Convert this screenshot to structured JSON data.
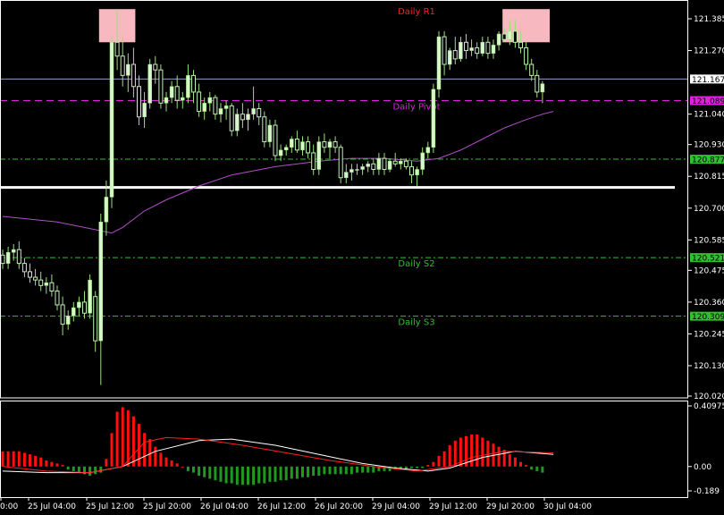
{
  "colors": {
    "background": "#000000",
    "bull_candle": "#d8f7c8",
    "bear_candle": "#c4f0bc",
    "wick": "#9be07f",
    "pivot": "#e020e0",
    "r1": "#ff2020",
    "support": "#2fbf2f",
    "bid_line": "#9999cc",
    "moving_average": "#b050c8",
    "highlight_box": "#f8b8c0",
    "hist_pos": "#ff1010",
    "hist_neg": "#1f9a1f",
    "signal_white": "#ffffff",
    "signal_red": "#ff2020"
  },
  "chart_data": [
    {
      "type": "candlestick",
      "ylim": [
        120.02,
        121.44
      ],
      "price_axis_ticks": [
        "121.385",
        "121.270",
        "121.040",
        "120.930",
        "120.815",
        "120.700",
        "120.585",
        "120.475",
        "120.360",
        "120.245",
        "120.130",
        "120.020"
      ],
      "time_axis_labels": [
        "0:00",
        "25 Jul 04:00",
        "25 Jul 12:00",
        "25 Jul 20:00",
        "26 Jul 04:00",
        "26 Jul 12:00",
        "26 Jul 20:00",
        "29 Jul 04:00",
        "29 Jul 12:00",
        "29 Jul 20:00",
        "30 Jul 04:00"
      ],
      "levels": [
        {
          "name": "Daily R1",
          "value": 121.43,
          "tag": ""
        },
        {
          "name": "Daily Pivot",
          "value": 121.089,
          "tag": "121.089"
        },
        {
          "name": "",
          "value": 120.877,
          "tag": "120.877"
        },
        {
          "name": "Daily S2",
          "value": 120.521,
          "tag": "120.521"
        },
        {
          "name": "Daily S3",
          "value": 120.309,
          "tag": "120.309"
        }
      ],
      "current_price": "121.167",
      "horizontal_line": 120.775,
      "highlight_boxes": [
        {
          "bar_from": 18,
          "bar_to": 24,
          "y_from": 121.3,
          "y_to": 121.42
        },
        {
          "bar_from": 92,
          "bar_to": 100,
          "y_from": 121.3,
          "y_to": 121.42
        }
      ],
      "candles": [
        [
          120.53,
          120.55,
          120.48,
          120.5
        ],
        [
          120.5,
          120.56,
          120.48,
          120.54
        ],
        [
          120.54,
          120.57,
          120.51,
          120.55
        ],
        [
          120.55,
          120.58,
          120.48,
          120.5
        ],
        [
          120.5,
          120.52,
          120.45,
          120.47
        ],
        [
          120.47,
          120.5,
          120.43,
          120.45
        ],
        [
          120.45,
          120.48,
          120.42,
          120.44
        ],
        [
          120.44,
          120.47,
          120.4,
          120.42
        ],
        [
          120.42,
          120.45,
          120.39,
          120.43
        ],
        [
          120.43,
          120.46,
          120.38,
          120.4
        ],
        [
          120.4,
          120.42,
          120.33,
          120.35
        ],
        [
          120.35,
          120.38,
          120.24,
          120.28
        ],
        [
          120.28,
          120.33,
          120.26,
          120.31
        ],
        [
          120.31,
          120.36,
          120.29,
          120.34
        ],
        [
          120.34,
          120.38,
          120.31,
          120.36
        ],
        [
          120.36,
          120.4,
          120.3,
          120.32
        ],
        [
          120.32,
          120.46,
          120.3,
          120.44
        ],
        [
          120.38,
          120.4,
          120.18,
          120.22
        ],
        [
          120.22,
          120.68,
          120.06,
          120.65
        ],
        [
          120.65,
          120.8,
          120.6,
          120.74
        ],
        [
          120.74,
          121.32,
          120.7,
          121.3
        ],
        [
          121.3,
          121.42,
          121.2,
          121.25
        ],
        [
          121.25,
          121.32,
          121.14,
          121.18
        ],
        [
          121.18,
          121.26,
          121.12,
          121.22
        ],
        [
          121.22,
          121.28,
          121.1,
          121.14
        ],
        [
          121.14,
          121.18,
          121.0,
          121.03
        ],
        [
          121.03,
          121.12,
          120.99,
          121.08
        ],
        [
          121.08,
          121.24,
          121.06,
          121.22
        ],
        [
          121.22,
          121.25,
          121.15,
          121.2
        ],
        [
          121.2,
          121.22,
          121.06,
          121.08
        ],
        [
          121.08,
          121.12,
          121.05,
          121.1
        ],
        [
          121.1,
          121.16,
          121.08,
          121.14
        ],
        [
          121.14,
          121.18,
          121.06,
          121.09
        ],
        [
          121.09,
          121.12,
          121.06,
          121.1
        ],
        [
          121.1,
          121.22,
          121.08,
          121.18
        ],
        [
          121.18,
          121.2,
          121.08,
          121.12
        ],
        [
          121.12,
          121.15,
          121.03,
          121.05
        ],
        [
          121.05,
          121.1,
          121.02,
          121.08
        ],
        [
          121.08,
          121.12,
          121.05,
          121.1
        ],
        [
          121.1,
          121.11,
          121.02,
          121.04
        ],
        [
          121.04,
          121.08,
          121.01,
          121.06
        ],
        [
          121.06,
          121.09,
          121.02,
          121.07
        ],
        [
          121.07,
          121.08,
          120.96,
          120.98
        ],
        [
          120.98,
          121.06,
          120.96,
          121.04
        ],
        [
          121.04,
          121.08,
          120.99,
          121.02
        ],
        [
          121.02,
          121.06,
          120.98,
          121.04
        ],
        [
          121.04,
          121.14,
          121.02,
          121.06
        ],
        [
          121.06,
          121.08,
          121.0,
          121.03
        ],
        [
          121.03,
          121.05,
          120.92,
          120.94
        ],
        [
          120.94,
          121.02,
          120.92,
          121.0
        ],
        [
          121.0,
          121.02,
          120.87,
          120.89
        ],
        [
          120.89,
          120.93,
          120.87,
          120.91
        ],
        [
          120.91,
          120.93,
          120.89,
          120.92
        ],
        [
          120.92,
          120.96,
          120.9,
          120.95
        ],
        [
          120.95,
          120.98,
          120.9,
          120.91
        ],
        [
          120.91,
          120.96,
          120.89,
          120.94
        ],
        [
          120.94,
          120.96,
          120.88,
          120.9
        ],
        [
          120.9,
          120.93,
          120.82,
          120.84
        ],
        [
          120.84,
          120.96,
          120.82,
          120.94
        ],
        [
          120.94,
          120.97,
          120.9,
          120.92
        ],
        [
          120.92,
          120.95,
          120.88,
          120.94
        ],
        [
          120.94,
          120.96,
          120.9,
          120.92
        ],
        [
          120.92,
          120.93,
          120.79,
          120.81
        ],
        [
          120.81,
          120.86,
          120.79,
          120.83
        ],
        [
          120.83,
          120.86,
          120.8,
          120.84
        ],
        [
          120.84,
          120.86,
          120.82,
          120.84
        ],
        [
          120.84,
          120.86,
          120.82,
          120.85
        ],
        [
          120.85,
          120.87,
          120.83,
          120.86
        ],
        [
          120.86,
          120.88,
          120.82,
          120.84
        ],
        [
          120.84,
          120.9,
          120.82,
          120.88
        ],
        [
          120.88,
          120.9,
          120.82,
          120.84
        ],
        [
          120.84,
          120.88,
          120.83,
          120.87
        ],
        [
          120.87,
          120.9,
          120.85,
          120.86
        ],
        [
          120.86,
          120.88,
          120.84,
          120.87
        ],
        [
          120.87,
          120.88,
          120.84,
          120.85
        ],
        [
          120.85,
          120.87,
          120.79,
          120.82
        ],
        [
          120.82,
          120.85,
          120.78,
          120.84
        ],
        [
          120.84,
          120.92,
          120.82,
          120.9
        ],
        [
          120.9,
          120.94,
          120.88,
          120.92
        ],
        [
          120.92,
          121.15,
          120.9,
          121.13
        ],
        [
          121.13,
          121.34,
          121.1,
          121.32
        ],
        [
          121.32,
          121.34,
          121.18,
          121.22
        ],
        [
          121.22,
          121.28,
          121.2,
          121.27
        ],
        [
          121.27,
          121.32,
          121.22,
          121.24
        ],
        [
          121.24,
          121.32,
          121.23,
          121.3
        ],
        [
          121.3,
          121.33,
          121.24,
          121.27
        ],
        [
          121.27,
          121.31,
          121.25,
          121.28
        ],
        [
          121.28,
          121.3,
          121.24,
          121.26
        ],
        [
          121.26,
          121.32,
          121.25,
          121.3
        ],
        [
          121.3,
          121.32,
          121.24,
          121.26
        ],
        [
          121.26,
          121.31,
          121.24,
          121.29
        ],
        [
          121.29,
          121.34,
          121.27,
          121.33
        ],
        [
          121.33,
          121.35,
          121.3,
          121.31
        ],
        [
          121.31,
          121.38,
          121.29,
          121.34
        ],
        [
          121.34,
          121.38,
          121.28,
          121.3
        ],
        [
          121.3,
          121.34,
          121.26,
          121.28
        ],
        [
          121.28,
          121.3,
          121.2,
          121.22
        ],
        [
          121.22,
          121.24,
          121.16,
          121.18
        ],
        [
          121.18,
          121.2,
          121.1,
          121.12
        ],
        [
          121.12,
          121.16,
          121.08,
          121.15
        ]
      ],
      "moving_average": [
        [
          0,
          120.67
        ],
        [
          10,
          120.65
        ],
        [
          20,
          120.61
        ],
        [
          22,
          120.63
        ],
        [
          26,
          120.69
        ],
        [
          30,
          120.73
        ],
        [
          36,
          120.78
        ],
        [
          42,
          120.82
        ],
        [
          50,
          120.85
        ],
        [
          58,
          120.87
        ],
        [
          64,
          120.88
        ],
        [
          70,
          120.88
        ],
        [
          76,
          120.87
        ],
        [
          80,
          120.88
        ],
        [
          84,
          120.91
        ],
        [
          88,
          120.95
        ],
        [
          92,
          120.99
        ],
        [
          96,
          121.02
        ],
        [
          99,
          121.04
        ],
        [
          101,
          121.05
        ]
      ]
    },
    {
      "type": "bar",
      "ylim": [
        -0.189,
        0.40975
      ],
      "axis_ticks": [
        "0.40975",
        "0.00",
        "-0.189"
      ],
      "histogram": [
        0.1,
        0.1,
        0.1,
        0.1,
        0.09,
        0.08,
        0.07,
        0.06,
        0.04,
        0.03,
        0.02,
        0.01,
        -0.02,
        -0.03,
        -0.04,
        -0.05,
        -0.06,
        -0.05,
        -0.04,
        0.05,
        0.22,
        0.36,
        0.39,
        0.37,
        0.33,
        0.28,
        0.22,
        0.18,
        0.13,
        0.09,
        0.06,
        0.04,
        0.02,
        0.0,
        -0.03,
        -0.04,
        -0.06,
        -0.07,
        -0.08,
        -0.09,
        -0.1,
        -0.11,
        -0.11,
        -0.12,
        -0.12,
        -0.12,
        -0.12,
        -0.11,
        -0.11,
        -0.1,
        -0.1,
        -0.09,
        -0.09,
        -0.08,
        -0.08,
        -0.07,
        -0.07,
        -0.06,
        -0.06,
        -0.05,
        -0.05,
        -0.05,
        -0.05,
        -0.05,
        -0.05,
        -0.04,
        -0.04,
        -0.04,
        -0.04,
        -0.03,
        -0.03,
        -0.03,
        -0.02,
        -0.02,
        -0.02,
        -0.01,
        -0.01,
        -0.01,
        0.01,
        0.03,
        0.07,
        0.1,
        0.14,
        0.17,
        0.19,
        0.2,
        0.21,
        0.21,
        0.19,
        0.17,
        0.15,
        0.13,
        0.11,
        0.08,
        0.06,
        0.03,
        0.01,
        -0.02,
        -0.03,
        -0.04
      ],
      "signal_white": [
        [
          0,
          -0.03
        ],
        [
          8,
          -0.04
        ],
        [
          16,
          -0.04
        ],
        [
          22,
          0.0
        ],
        [
          28,
          0.1
        ],
        [
          36,
          0.17
        ],
        [
          42,
          0.18
        ],
        [
          50,
          0.14
        ],
        [
          58,
          0.08
        ],
        [
          66,
          0.02
        ],
        [
          72,
          -0.01
        ],
        [
          78,
          -0.03
        ],
        [
          82,
          -0.01
        ],
        [
          88,
          0.06
        ],
        [
          94,
          0.1
        ],
        [
          101,
          0.08
        ]
      ],
      "signal_red": [
        [
          0,
          0.0
        ],
        [
          8,
          -0.03
        ],
        [
          16,
          -0.04
        ],
        [
          22,
          0.0
        ],
        [
          26,
          0.16
        ],
        [
          30,
          0.19
        ],
        [
          36,
          0.18
        ],
        [
          44,
          0.14
        ],
        [
          52,
          0.09
        ],
        [
          60,
          0.04
        ],
        [
          68,
          0.0
        ],
        [
          76,
          -0.03
        ],
        [
          82,
          0.0
        ],
        [
          86,
          0.06
        ],
        [
          92,
          0.1
        ],
        [
          101,
          0.09
        ]
      ]
    }
  ]
}
